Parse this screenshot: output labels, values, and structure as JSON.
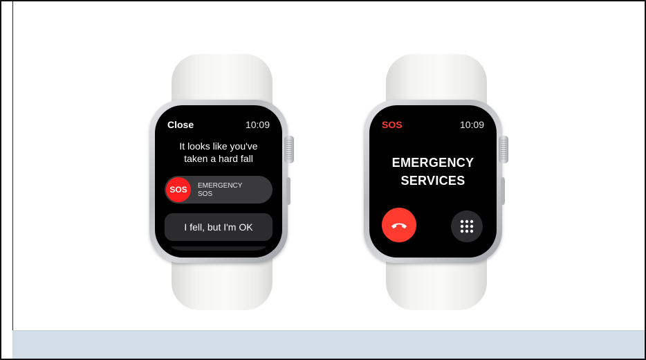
{
  "watch_left": {
    "close_label": "Close",
    "time": "10:09",
    "fall_message_line1": "It looks like you've",
    "fall_message_line2": "taken a hard fall",
    "sos_knob": "SOS",
    "slider_label_line1": "EMERGENCY",
    "slider_label_line2": "SOS",
    "ok_button": "I fell, but I'm OK"
  },
  "watch_right": {
    "sos_label": "SOS",
    "time": "10:09",
    "title_line1": "EMERGENCY",
    "title_line2": "SERVICES",
    "end_call_icon": "phone-hangup-icon",
    "keypad_icon": "keypad-icon"
  },
  "colors": {
    "sos_red": "#ff3b30",
    "screen_bg": "#000000",
    "footer_strip": "#d3dde8"
  }
}
